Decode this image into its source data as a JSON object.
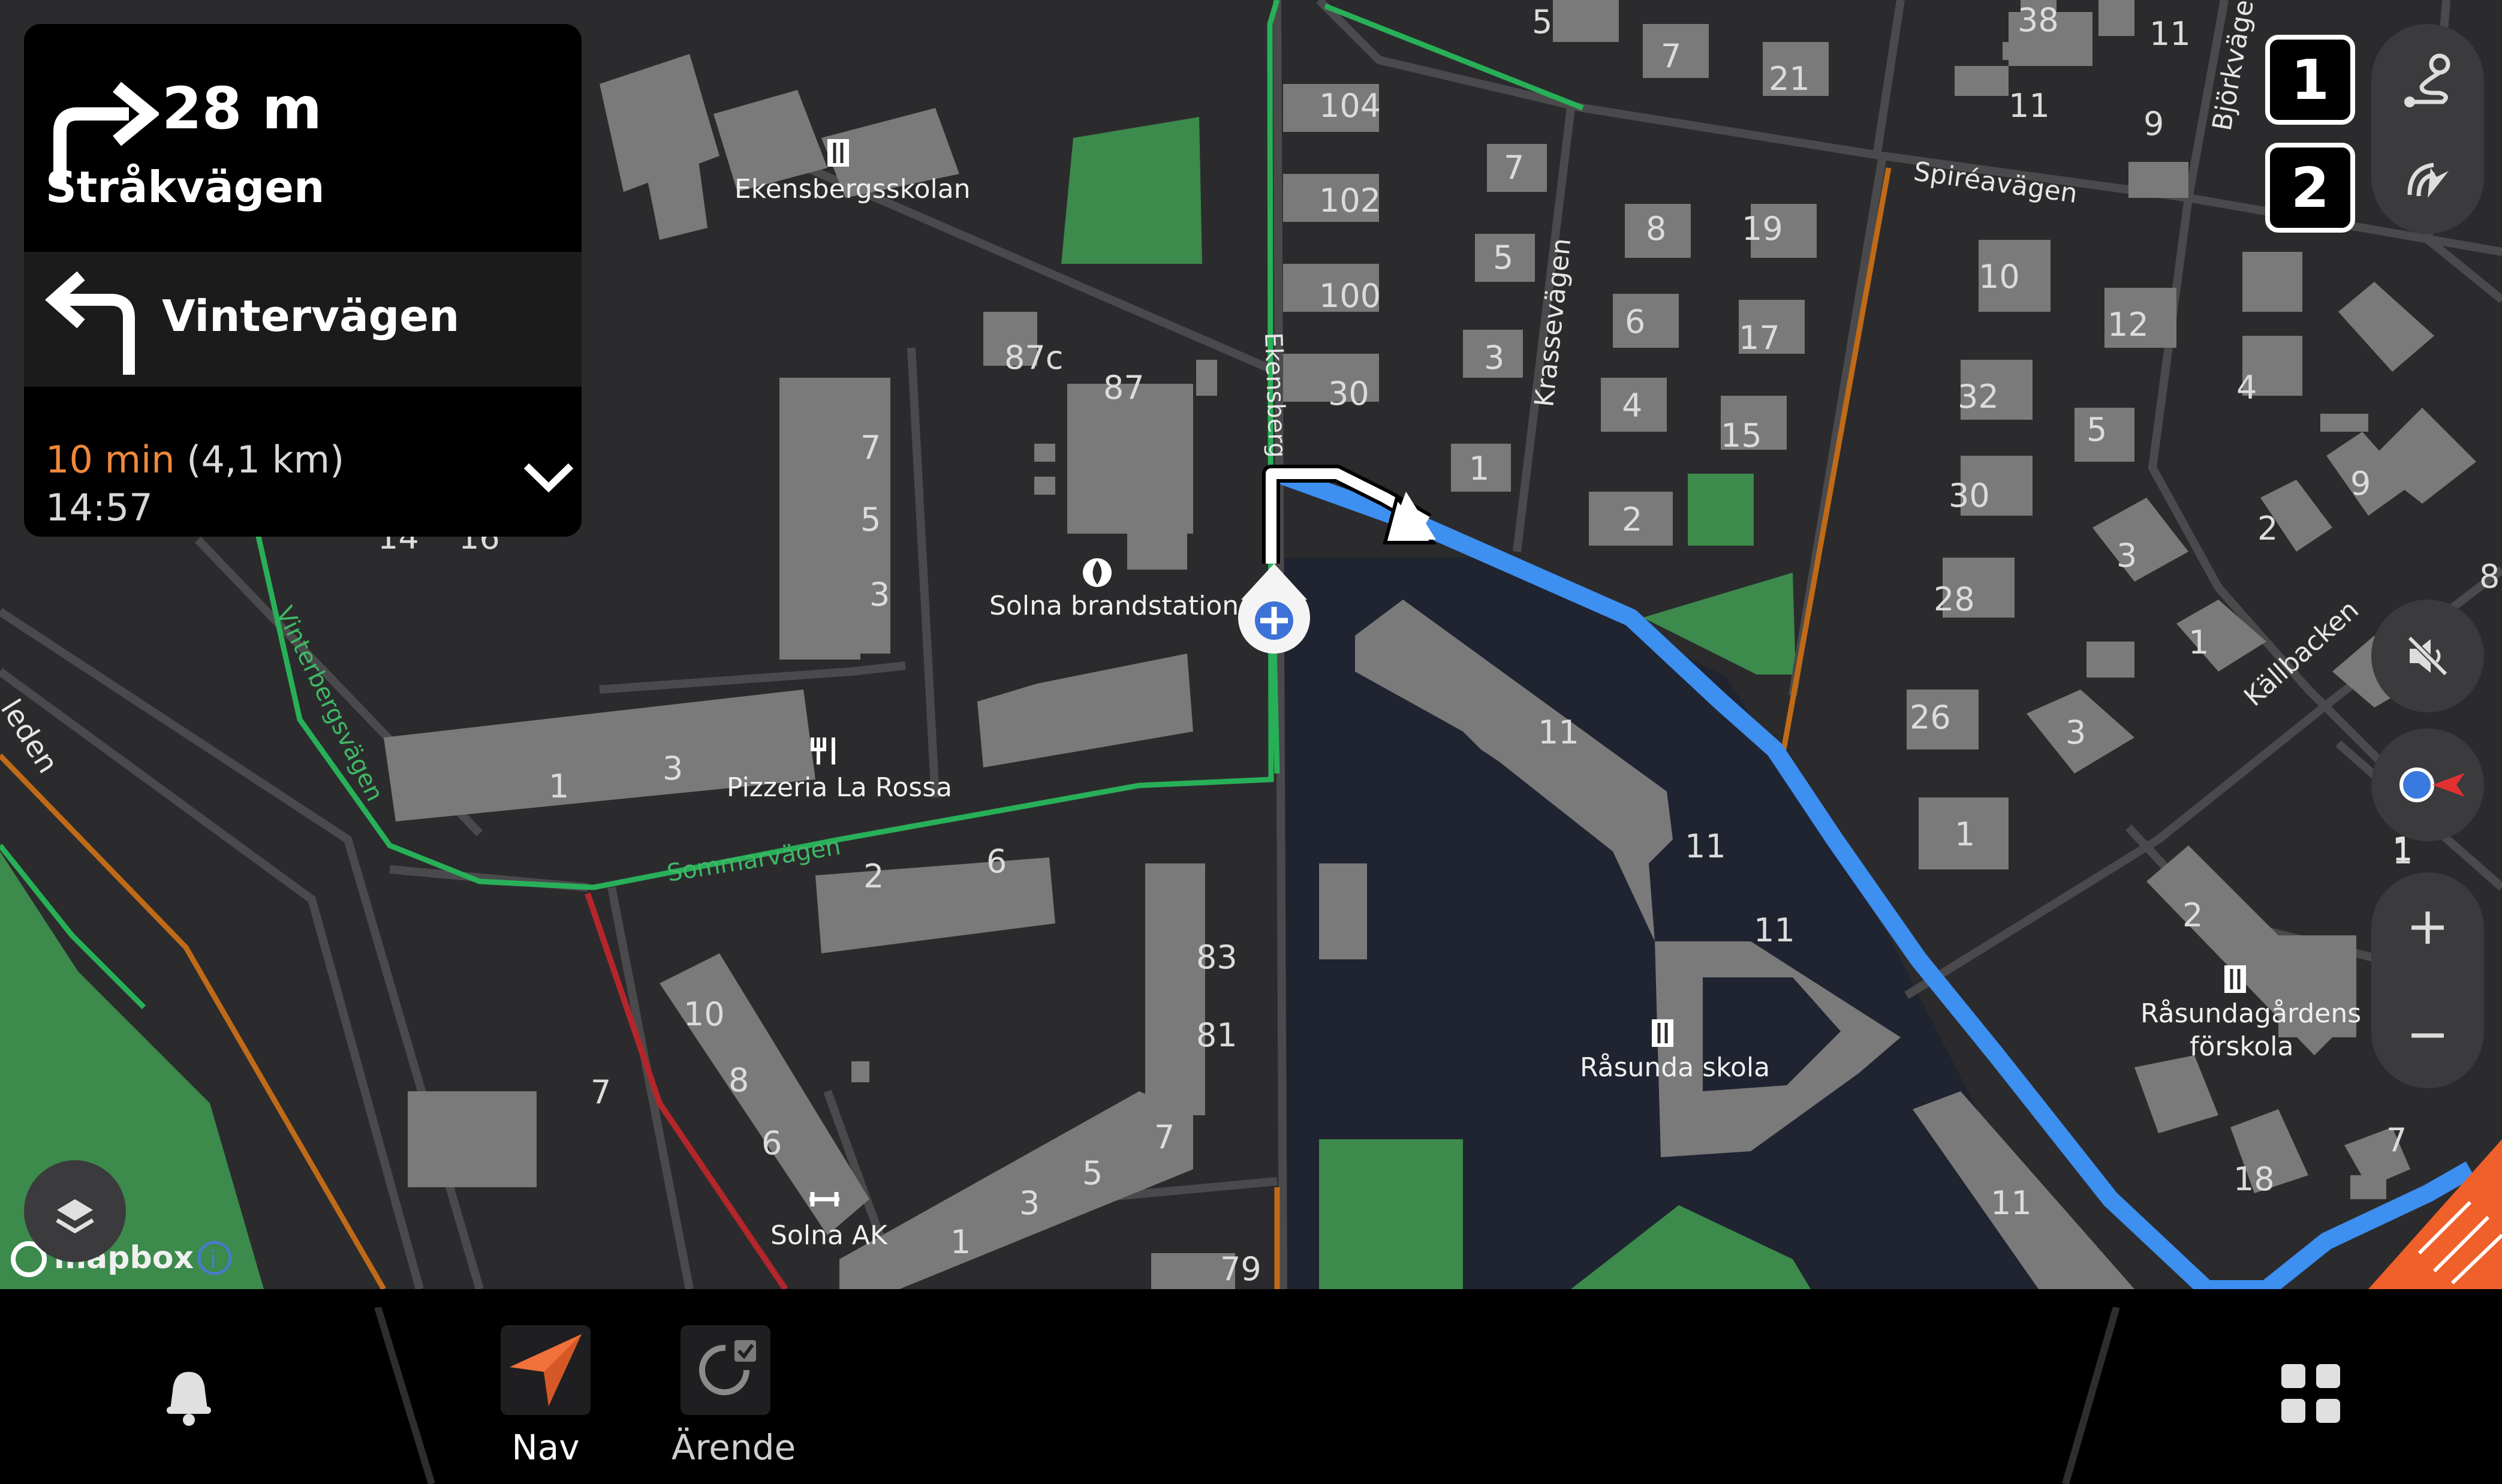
{
  "instruction_panel": {
    "next": {
      "distance": "28 m",
      "street": "Stråkvägen",
      "icon": "turn-right-arrow-icon"
    },
    "then": {
      "street": "Vintervägen",
      "icon": "turn-left-arrow-icon"
    },
    "eta": {
      "duration": "10 min",
      "distance": "(4,1 km)",
      "arrival": "14:57"
    },
    "expand_icon": "chevron-down-icon"
  },
  "map": {
    "street_labels": {
      "spireavagen": "Spiréavägen",
      "krassevagen": "Krassevägen",
      "bjorkvage": "Björkväge",
      "kallbacken": "Källbacken",
      "sommarvagen": "Sommarvägen",
      "vinterbergsvagen": "Vinterbergsvägen",
      "ekensberg": "Ekensberg",
      "leden": "leden"
    },
    "pois": {
      "school1": "Ekensbergsskolan",
      "fire_station": "Solna brandstation",
      "restaurant": "Pizzeria La Rossa",
      "school2": "Råsunda skola",
      "preschool_line1": "Råsundagårdens",
      "preschool_line2": "förskola",
      "gym": "Solna AK"
    },
    "house_numbers": {
      "n5a": "5",
      "n7a": "7",
      "n21": "21",
      "n38": "38",
      "n11a": "11",
      "n11b": "11",
      "n9a": "9",
      "n104": "104",
      "n102": "102",
      "n100": "100",
      "n30a": "30",
      "n7b": "7",
      "n5b": "5",
      "n3a": "3",
      "n1a": "1",
      "n8a": "8",
      "n19": "19",
      "n6a": "6",
      "n17": "17",
      "n4a": "4",
      "n15": "15",
      "n2a": "2",
      "n10a": "10",
      "n12": "12",
      "n32": "32",
      "n5c": "5",
      "n30b": "30",
      "n28": "28",
      "n26": "26",
      "n3b": "3",
      "n3c": "3",
      "n1b": "1",
      "n4b": "4",
      "n9b": "9",
      "n2b": "2",
      "n1c": "1",
      "n8b": "8",
      "n1d": "1",
      "n87c": "87c",
      "n87": "87",
      "n7c": "7",
      "n5d": "5",
      "n3d": "3",
      "n14": "14",
      "n16": "16",
      "n1e": "1",
      "n3e": "3",
      "n2c": "2",
      "n6b": "6",
      "n83": "83",
      "n81": "81",
      "n10b": "10",
      "n8c": "8",
      "n6c": "6",
      "n7d": "7",
      "n7e": "7",
      "n5e": "5",
      "n3f": "3",
      "n1f": "1",
      "n79": "79",
      "n11c": "11",
      "n11d": "11",
      "n11e": "11",
      "n11f": "11",
      "n2d": "2",
      "n18": "18",
      "n7f": "7"
    },
    "attribution": "mapbox",
    "attribution_info": "i"
  },
  "controls": {
    "badge1": "1",
    "badge2": "2",
    "route_overview_icon": "route-overview-icon",
    "lane_icon": "route-preview-icon",
    "mute_icon": "speaker-muted-icon",
    "compass_icon": "compass-icon",
    "compass_value": "1",
    "zoom_in": "+",
    "zoom_out": "−",
    "layers_icon": "layers-icon"
  },
  "bottom_bar": {
    "bell_icon": "bell-icon",
    "nav_label": "Nav",
    "arende_label": "Ärende",
    "grid_icon": "app-grid-icon"
  },
  "colors": {
    "route": "#3d8ff0",
    "accent": "#f0883c",
    "map_bg": "#2b2b2d",
    "building": "#7a7a7a",
    "park": "#3c8a4c",
    "water": "#1f2430"
  }
}
